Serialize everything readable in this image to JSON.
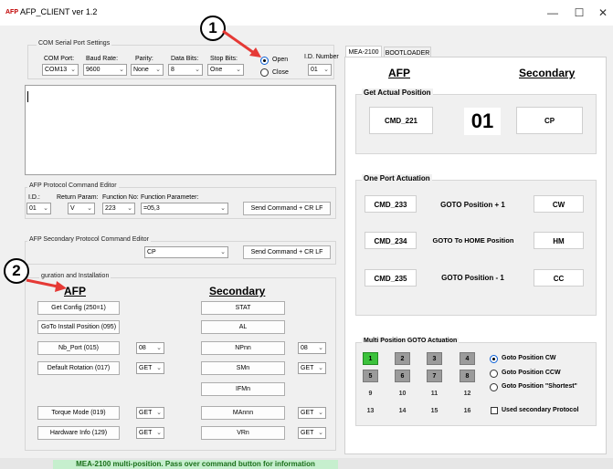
{
  "window": {
    "title": "AFP_CLIENT ver 1.2",
    "icon_text": "AFP",
    "minimize": "—",
    "maximize": "☐",
    "close": "✕"
  },
  "annotations": {
    "one": "1",
    "two": "2"
  },
  "com": {
    "group_label": "COM Serial Port Settings",
    "port_label": "COM Port:",
    "port_value": "COM13",
    "baud_label": "Baud Rate:",
    "baud_value": "9600",
    "parity_label": "Parity:",
    "parity_value": "None",
    "databits_label": "Data Bits:",
    "databits_value": "8",
    "stopbits_label": "Stop Bits:",
    "stopbits_value": "One",
    "open_label": "Open",
    "close_label": "Close",
    "id_label": "I.D. Number",
    "id_value": "01"
  },
  "cmd_editor": {
    "group_label": "AFP Protocol Command Editor",
    "id_label": "I.D.:",
    "id_value": "01",
    "return_label": "Return Param:",
    "return_value": "V",
    "func_label": "Function No:",
    "func_value": "223",
    "param_label": "Function Parameter:",
    "param_value": "=05,3",
    "send_label": "Send Command + CR LF"
  },
  "sec_editor": {
    "group_label": "AFP Secondary Protocol Command Editor",
    "value": "CP",
    "send_label": "Send Command + CR LF"
  },
  "config": {
    "group_label": "guration and Installation",
    "afp_header": "AFP",
    "secondary_header": "Secondary",
    "get_config": "Get Config (250=1)",
    "stat": "STAT",
    "goto_install": "GoTo Install Position (095)",
    "al": "AL",
    "nb_port": "Nb_Port (015)",
    "nb_port_val": "08",
    "npnn": "NPnn",
    "npnn_val": "08",
    "default_rot": "Default Rotation (017)",
    "default_rot_val": "GET",
    "smn": "SMn",
    "smn_val": "GET",
    "ifmn": "IFMn",
    "torque": "Torque Mode (019)",
    "torque_val": "GET",
    "mannn": "MAnnn",
    "mannn_val": "GET",
    "hw_info": "Hardware Info (129)",
    "hw_info_val": "GET",
    "vrn": "VRn",
    "vrn_val": "GET"
  },
  "tabs": [
    "MEA-2100",
    "BOOTLOADER"
  ],
  "right": {
    "afp_header": "AFP",
    "secondary_header": "Secondary",
    "actual_group": "Get Actual Position",
    "cmd_221": "CMD_221",
    "position_value": "01",
    "cp": "CP",
    "one_port_group": "One Port Actuation",
    "rows": [
      {
        "cmd": "CMD_233",
        "label": "GOTO Position + 1",
        "sec": "CW"
      },
      {
        "cmd": "CMD_234",
        "label": "GOTO To HOME Position",
        "sec": "HM"
      },
      {
        "cmd": "CMD_235",
        "label": "GOTO Position - 1",
        "sec": "CC"
      }
    ],
    "multi_group": "Multi Position GOTO Actuation",
    "positions": [
      "1",
      "2",
      "3",
      "4",
      "5",
      "6",
      "7",
      "8",
      "9",
      "10",
      "11",
      "12",
      "13",
      "14",
      "15",
      "16"
    ],
    "goto_cw": "Goto Position CW",
    "goto_ccw": "Goto Position CCW",
    "goto_shortest": "Goto Position \"Shortest\"",
    "used_secondary": "Used secondary Protocol"
  },
  "status": "MEA-2100 multi-position. Pass over command button for information",
  "colors": {
    "active_position": "#3cc23c",
    "status_bg": "#c6efce",
    "arrow": "#e53935"
  }
}
